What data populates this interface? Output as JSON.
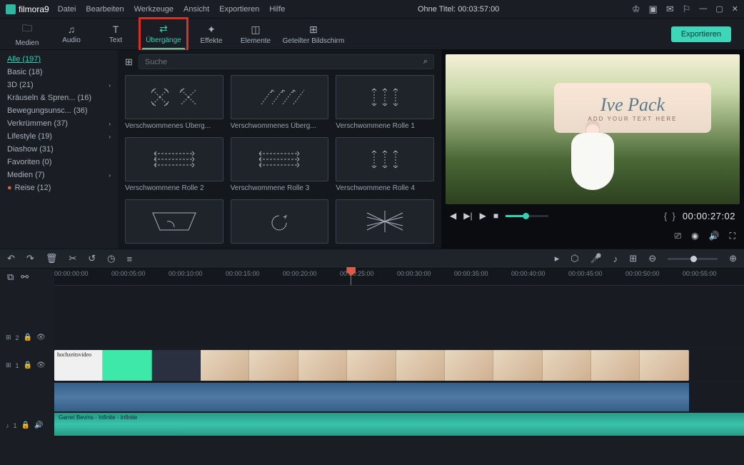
{
  "app": {
    "name": "filmora",
    "version": "9"
  },
  "menu": [
    "Datei",
    "Bearbeiten",
    "Werkzeuge",
    "Ansicht",
    "Exportieren",
    "Hilfe"
  ],
  "title": "Ohne Titel: 00:03:57:00",
  "tabs": [
    {
      "label": "Medien",
      "icon": "folder"
    },
    {
      "label": "Audio",
      "icon": "audio"
    },
    {
      "label": "Text",
      "icon": "text"
    },
    {
      "label": "Übergänge",
      "icon": "transition",
      "active": true
    },
    {
      "label": "Effekte",
      "icon": "sparkle"
    },
    {
      "label": "Elemente",
      "icon": "elements"
    },
    {
      "label": "Geteilter Bildschirm",
      "icon": "split"
    }
  ],
  "export_label": "Exportieren",
  "categories": [
    {
      "label": "Alle (197)",
      "selected": true
    },
    {
      "label": "Basic (18)"
    },
    {
      "label": "3D (21)",
      "expandable": true
    },
    {
      "label": "Kräuseln & Spren... (16)"
    },
    {
      "label": "Bewegungsunsc... (36)"
    },
    {
      "label": "Verkrümmen (37)",
      "expandable": true
    },
    {
      "label": "Lifestyle (19)",
      "expandable": true
    },
    {
      "label": "Diashow (31)"
    },
    {
      "label": "Favoriten (0)"
    },
    {
      "label": "Medien (7)",
      "expandable": true
    },
    {
      "label": "Reise (12)",
      "dot": true
    }
  ],
  "search": {
    "placeholder": "Suche"
  },
  "thumbs": [
    "Verschwommenes Überg...",
    "Verschwommenes Überg...",
    "Verschwommene Rolle 1",
    "Verschwommene Rolle 2",
    "Verschwommene Rolle 3",
    "Verschwommene Rolle 4"
  ],
  "preview": {
    "title": "Ive Pack",
    "subtitle": "ADD YOUR TEXT HERE",
    "time": "00:00:27:02"
  },
  "ruler_marks": [
    "00:00:00:00",
    "00:00:05:00",
    "00:00:10:00",
    "00:00:15:00",
    "00:00:20:00",
    "00:00:25:00",
    "00:00:30:00",
    "00:00:35:00",
    "00:00:40:00",
    "00:00:45:00",
    "00:00:50:00",
    "00:00:55:00"
  ],
  "tracks": {
    "v2": "2",
    "v1": "1",
    "a1": "1",
    "clip_text": "hochzeitsvideo",
    "audio_label": "Garret Bevins - Infinite - Infinite"
  }
}
